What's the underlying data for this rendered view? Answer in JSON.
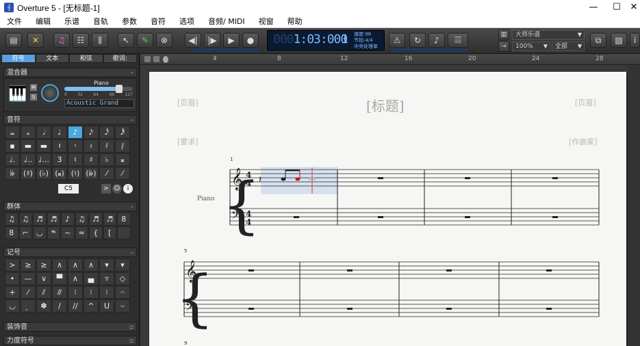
{
  "window": {
    "title": "Overture 5 - [无标题-1]",
    "minimize": "—",
    "maximize": "☐",
    "close": "✕"
  },
  "menu": [
    "文件",
    "编辑",
    "乐谱",
    "音轨",
    "参数",
    "音符",
    "选项",
    "音频/ MIDI",
    "视窗",
    "帮助"
  ],
  "transport": {
    "time_dim": "000",
    "time": "1:03:000",
    "measure": "1",
    "tempo": "速度:96",
    "meter": "节拍:4/4",
    "status": "中央处理单"
  },
  "toolbar_right": {
    "style_dropdown": "大师乐谱",
    "zoom_dropdown": "100%",
    "scope_dropdown": "全部"
  },
  "left_tabs": [
    "符号",
    "文本",
    "和弦",
    "歌词:"
  ],
  "mixer": {
    "title": "混合器",
    "instrument": "Piano",
    "patch": "Acoustic Grand",
    "m_label": "M",
    "s_label": "S",
    "scale": [
      "0",
      "32",
      "64",
      "96",
      "127"
    ],
    "volume": 0.8
  },
  "notes_palette": {
    "title": "音符",
    "row1": [
      "𝅜",
      "𝅝",
      "𝅗𝅥",
      "♩",
      "♪",
      "𝅘𝅥𝅯",
      "𝅘𝅥𝅰",
      "𝅘𝅥𝅱"
    ],
    "row2": [
      "▪",
      "▬",
      "▬",
      "𝄽",
      "𝄾",
      "𝄿",
      "𝅀",
      "𝅁"
    ],
    "row3": [
      "♩.",
      "♩..",
      "♩...",
      "3",
      "♮",
      "♯",
      "♭",
      "𝄪"
    ],
    "row4": [
      "𝄫",
      "(♯)",
      "(♭)",
      "(𝄪)",
      "(♮)",
      "(𝄫)",
      "⁄",
      "⁄"
    ],
    "pitch": "C5"
  },
  "groups_palette": {
    "title": "群体"
  },
  "marks_palette": {
    "title": "记号",
    "row1": [
      ">",
      "≥",
      "≥",
      "∧",
      "∧",
      "∧",
      "▾",
      "▾"
    ],
    "row2": [
      "•",
      "—",
      "∨",
      "▀",
      "∧",
      "▄",
      "▿",
      "◇"
    ],
    "row3": [
      "+",
      "⁄",
      "⫽",
      "⫻",
      "⁝",
      "⁝",
      "⁝",
      "𝄐"
    ],
    "row4": [
      "◡",
      "𝆊",
      "✽",
      "/",
      "//",
      "^",
      "U",
      "𝄑"
    ]
  },
  "ornaments_palette": {
    "title": "装饰音"
  },
  "dynamics_palette": {
    "title": "力度符号"
  },
  "ruler": [
    "4",
    "8",
    "12",
    "16",
    "20",
    "24",
    "28"
  ],
  "score": {
    "header_left": "[页眉]",
    "header_right": "[页眉]",
    "title": "[标题]",
    "instructions": "[要求]",
    "composer": "[作曲家]",
    "instrument": "Piano",
    "system1_measure": "1",
    "system2_measure": "5",
    "system3_measure": "9",
    "time_sig": "4"
  },
  "colors": {
    "accent": "#48a8e0",
    "lcd_text": "#7fb8ff",
    "selected_note": "#d01010"
  }
}
